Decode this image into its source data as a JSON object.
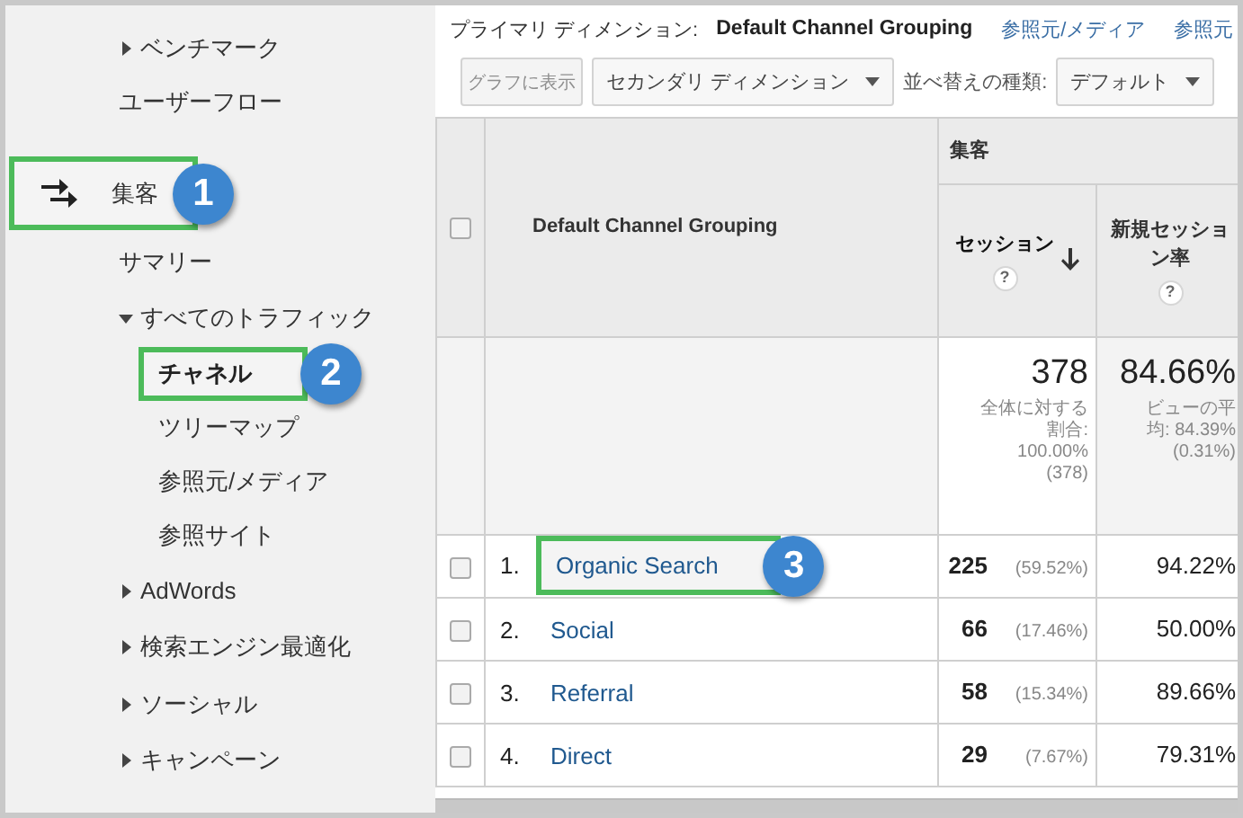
{
  "sidebar": {
    "items": [
      {
        "label": "ベンチマーク",
        "kind": "expandable",
        "expanded": false,
        "selected": false
      },
      {
        "label": "ユーザーフロー",
        "kind": "link",
        "selected": false
      },
      {
        "label": "集客",
        "kind": "section",
        "selected": false,
        "callout": "1",
        "children": [
          {
            "label": "サマリー",
            "kind": "link",
            "selected": false
          },
          {
            "label": "すべてのトラフィック",
            "kind": "expandable",
            "expanded": true,
            "selected": false,
            "children": [
              {
                "label": "チャネル",
                "selected": true,
                "callout": "2"
              },
              {
                "label": "ツリーマップ",
                "selected": false
              },
              {
                "label": "参照元/メディア",
                "selected": false
              },
              {
                "label": "参照サイト",
                "selected": false
              }
            ]
          },
          {
            "label": "AdWords",
            "kind": "expandable",
            "expanded": false,
            "selected": false
          },
          {
            "label": "検索エンジン最適化",
            "kind": "expandable",
            "expanded": false,
            "selected": false
          },
          {
            "label": "ソーシャル",
            "kind": "expandable",
            "expanded": false,
            "selected": false
          },
          {
            "label": "キャンペーン",
            "kind": "expandable",
            "expanded": false,
            "selected": false
          }
        ]
      }
    ]
  },
  "primary_dimension": {
    "label": "プライマリ ディメンション:",
    "options": [
      {
        "label": "Default Channel Grouping",
        "selected": true
      },
      {
        "label": "参照元/メディア",
        "selected": false
      },
      {
        "label": "参照元",
        "selected": false
      }
    ]
  },
  "toolbar": {
    "chart_button": {
      "label": "グラフに表示",
      "disabled": true
    },
    "secondary_dimension": "セカンダリ ディメンション",
    "sort_label": "並べ替えの種類:",
    "sort_value": "デフォルト"
  },
  "table": {
    "group_header": "集客",
    "select_all": {
      "checked": false
    },
    "columns": [
      {
        "label": "Default Channel Grouping"
      },
      {
        "label": "セッション",
        "sorted": true,
        "help": "?"
      },
      {
        "label": "新規セッション率",
        "sorted": false,
        "help": "?"
      }
    ],
    "totals": [
      {
        "value": "378",
        "note_lines": [
          "全体に対する",
          "割合:",
          "100.00%",
          "(378)"
        ]
      },
      {
        "value": "84.66%",
        "note_lines": [
          "ビューの平",
          "均: 84.39%",
          "(0.31%)"
        ]
      }
    ],
    "rows": [
      {
        "index": "1.",
        "name": "Organic Search",
        "sessions": "225",
        "share": "(59.52%)",
        "new_rate": "94.22%",
        "checked": false,
        "callout": "3"
      },
      {
        "index": "2.",
        "name": "Social",
        "sessions": "66",
        "share": "(17.46%)",
        "new_rate": "50.00%",
        "checked": false
      },
      {
        "index": "3.",
        "name": "Referral",
        "sessions": "58",
        "share": "(15.34%)",
        "new_rate": "89.66%",
        "checked": false
      },
      {
        "index": "4.",
        "name": "Direct",
        "sessions": "29",
        "share": "(7.67%)",
        "new_rate": "79.31%",
        "checked": false
      }
    ]
  }
}
